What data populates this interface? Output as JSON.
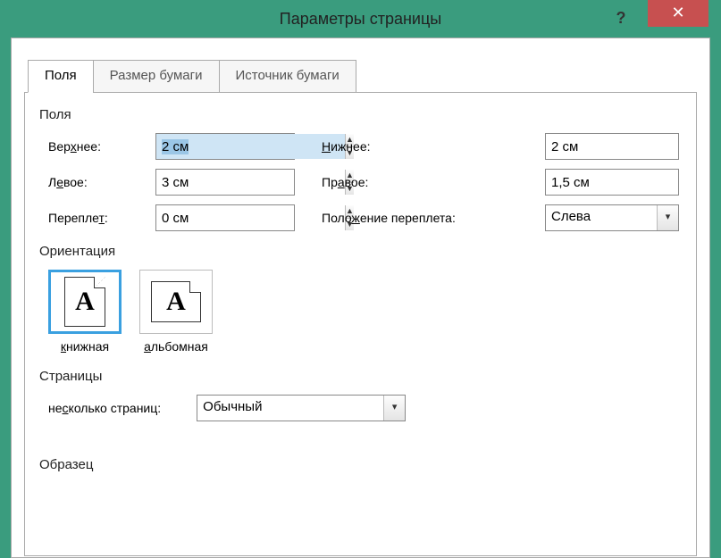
{
  "title": "Параметры страницы",
  "tabs": {
    "t0": "Поля",
    "t1": "Размер бумаги",
    "t2": "Источник бумаги"
  },
  "margins": {
    "section": "Поля",
    "top_label_pre": "Вер",
    "top_label_u": "х",
    "top_label_post": "нее:",
    "bottom_label_u": "Н",
    "bottom_label_post": "ижнее:",
    "left_label_pre": "Л",
    "left_label_u": "е",
    "left_label_post": "вое:",
    "right_label_pre": "Пр",
    "right_label_u": "а",
    "right_label_post": "вое:",
    "gutter_label_pre": "Перепле",
    "gutter_label_u": "т",
    "gutter_label_post": ":",
    "gutterpos_label_pre": "Поло",
    "gutterpos_label_u": "ж",
    "gutterpos_label_post": "ение переплета:",
    "top": "2 см",
    "bottom": "2 см",
    "left": "3 см",
    "right": "1,5 см",
    "gutter": "0 см",
    "gutterpos": "Слева"
  },
  "orientation": {
    "section": "Ориентация",
    "portrait_u": "к",
    "portrait_post": "нижная",
    "landscape_u": "а",
    "landscape_post": "льбомная"
  },
  "pages": {
    "section": "Страницы",
    "multi_label_pre": "не",
    "multi_label_u": "с",
    "multi_label_post": "колько страниц:",
    "multi_value": "Обычный"
  },
  "sample": {
    "section": "Образец"
  }
}
